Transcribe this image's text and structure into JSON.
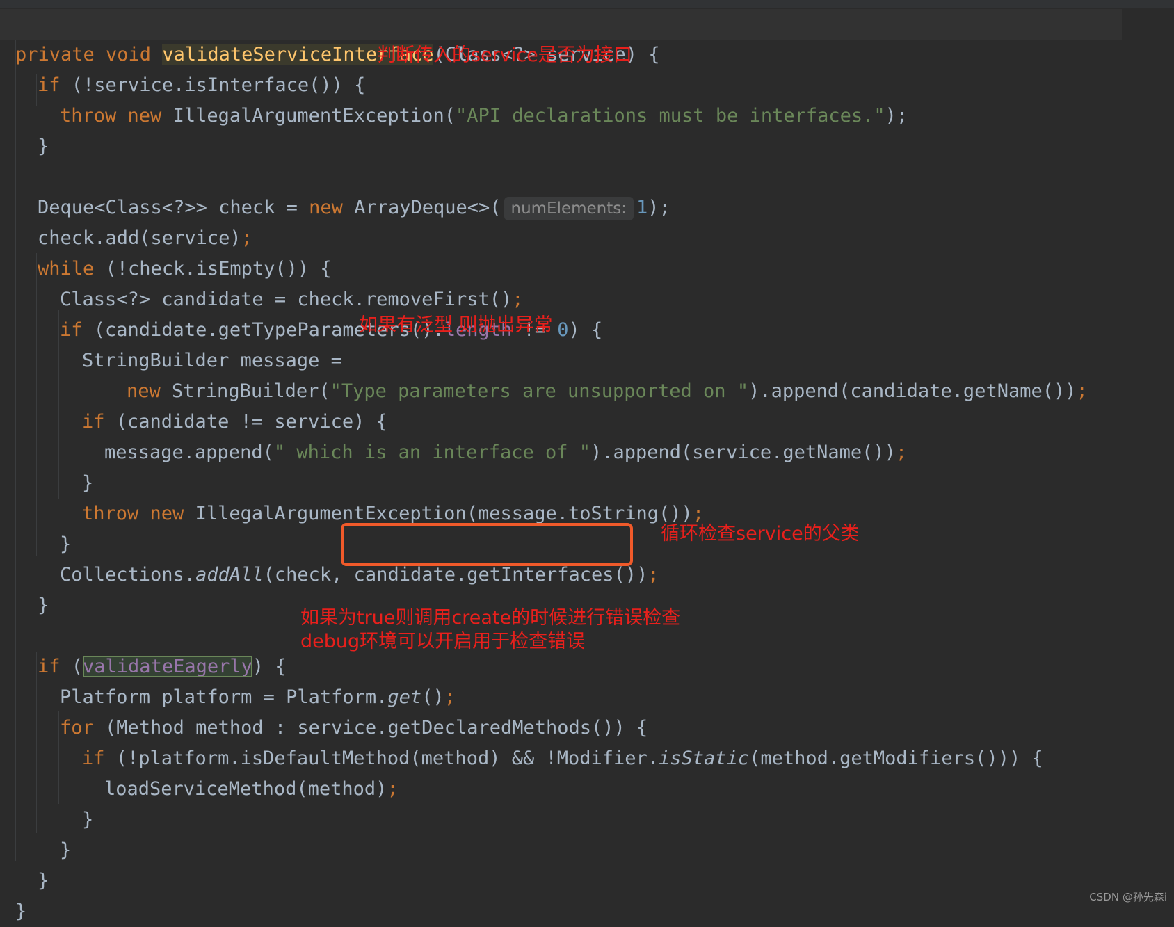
{
  "code": {
    "l01": {
      "a": "private void ",
      "b": "validateServiceInterface",
      "c": "(Class<?> service) {"
    },
    "l02": {
      "a": "if",
      "b": " (!service.isInterface()) {"
    },
    "l03": {
      "a": "throw new",
      "b": " IllegalArgumentException(",
      "c": "\"API declarations must be interfaces.\"",
      "d": ");"
    },
    "l04": {
      "a": "}"
    },
    "l05": {
      "a": "Deque<Class<?>> check = ",
      "b": "new",
      "c": " ArrayDeque<>(",
      "hint": "numElements:",
      "d": "1",
      "e": ");"
    },
    "l06": {
      "a": "check.add(service)",
      "b": ";"
    },
    "l07": {
      "a": "while",
      "b": " (!check.isEmpty()) {"
    },
    "l08": {
      "a": "Class<?> candidate = check.removeFirst()",
      "b": ";"
    },
    "l09": {
      "a": "if",
      "b": " (candidate.getTypeParameters().",
      "c": "length",
      "d": " != ",
      "e": "0",
      "f": ") {"
    },
    "l10": {
      "a": "StringBuilder message ="
    },
    "l11": {
      "a": "new",
      "b": " StringBuilder(",
      "c": "\"Type parameters are unsupported on \"",
      "d": ").append(candidate.getName())",
      "e": ";"
    },
    "l12": {
      "a": "if",
      "b": " (candidate != service) {"
    },
    "l13": {
      "a": "message.append(",
      "b": "\" which is an interface of \"",
      "c": ").append(service.getName())",
      "d": ";"
    },
    "l14": {
      "a": "}"
    },
    "l15": {
      "a": "throw new",
      "b": " IllegalArgumentException(message.toString())",
      "c": ";"
    },
    "l16": {
      "a": "}"
    },
    "l17": {
      "a": "Collections.",
      "b": "addAll",
      "c": "(check, ",
      "d": "candidate.getInterfaces()",
      "e": ")",
      "f": ";"
    },
    "l18": {
      "a": "}"
    },
    "l19": {
      "a": "if",
      "b": " (",
      "c": "validateEagerly",
      "d": ") {"
    },
    "l20": {
      "a": "Platform platform = Platform.",
      "b": "get",
      "c": "()",
      "d": ";"
    },
    "l21": {
      "a": "for",
      "b": " (Method method : service.getDeclaredMethods()) {"
    },
    "l22": {
      "a": "if",
      "b": " (!platform.isDefaultMethod(method) && !Modifier.",
      "c": "isStatic",
      "d": "(method.getModifiers())) {"
    },
    "l23": {
      "a": "loadServiceMethod(method)",
      "b": ";"
    },
    "l24": {
      "a": "}"
    },
    "l25": {
      "a": "}"
    },
    "l26": {
      "a": "}"
    },
    "l27": {
      "a": "}"
    }
  },
  "annotations": {
    "n1": "判断传入的service是否为接口",
    "n2": "如果有泛型 则抛出异常",
    "n3": "循环检查service的父类",
    "n4a": "如果为true则调用create的时候进行错误检查",
    "n4b": "debug环境可以开启用于检查错误"
  },
  "watermark": "CSDN @孙先森i",
  "colors": {
    "background": "#2b2b2b",
    "keyword": "#cc7832",
    "method_declaration": "#ffc66d",
    "string": "#6a8759",
    "number": "#6897bb",
    "field": "#9876aa",
    "annotation_text": "#e8201c",
    "highlight_box": "#f05a2a"
  }
}
